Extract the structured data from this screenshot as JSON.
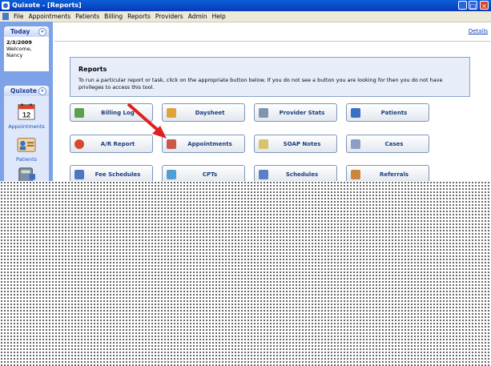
{
  "window": {
    "title": "Quixote - [Reports]",
    "min_symbol": "_",
    "max_symbol": "□",
    "close_symbol": "×"
  },
  "menu": [
    "File",
    "Appointments",
    "Patients",
    "Billing",
    "Reports",
    "Providers",
    "Admin",
    "Help"
  ],
  "today_panel": {
    "title": "Today",
    "date": "2/3/2009",
    "welcome": "Welcome,",
    "user": "Nancy",
    "collapse_symbol": "«"
  },
  "quixote_panel": {
    "title": "Quixote",
    "collapse_symbol": "«",
    "calendar_day": "12",
    "items": [
      {
        "label": "Appointments",
        "icon": "calendar-icon"
      },
      {
        "label": "Patients",
        "icon": "patient-card-icon"
      },
      {
        "label": "",
        "icon": "calculator-icon"
      }
    ]
  },
  "details_link": "Details",
  "reports": {
    "heading": "Reports",
    "description": "To run a particular report or task, click on the appropriate button below.  If you do not see a button you are looking for then you do not have privileges to access this tool.",
    "buttons": [
      {
        "label": "Billing Log",
        "icon": "ledger-icon",
        "color": "#5aa04f"
      },
      {
        "label": "Daysheet",
        "icon": "clipboard-icon",
        "color": "#e0a23c"
      },
      {
        "label": "Provider Stats",
        "icon": "provider-icon",
        "color": "#7f94b0"
      },
      {
        "label": "Patients",
        "icon": "patient-icon",
        "color": "#3a6fc4"
      },
      {
        "label": "A/R Report",
        "icon": "alarm-clock-icon",
        "color": "#d64a2a"
      },
      {
        "label": "Appointments",
        "icon": "appointment-calendar-icon",
        "color": "#c55a4a"
      },
      {
        "label": "SOAP Notes",
        "icon": "notes-icon",
        "color": "#d9c36a"
      },
      {
        "label": "Cases",
        "icon": "cases-icon",
        "color": "#8b9ec4"
      },
      {
        "label": "Fee Schedules",
        "icon": "fee-schedule-icon",
        "color": "#4d78c0"
      },
      {
        "label": "CPTs",
        "icon": "cpt-icon",
        "color": "#4f9fd6"
      },
      {
        "label": "Schedules",
        "icon": "schedules-icon",
        "color": "#5b7fc6"
      },
      {
        "label": "Referrals",
        "icon": "referrals-icon",
        "color": "#c9873e"
      }
    ]
  },
  "annotation": {
    "arrow_color": "#e02020"
  }
}
